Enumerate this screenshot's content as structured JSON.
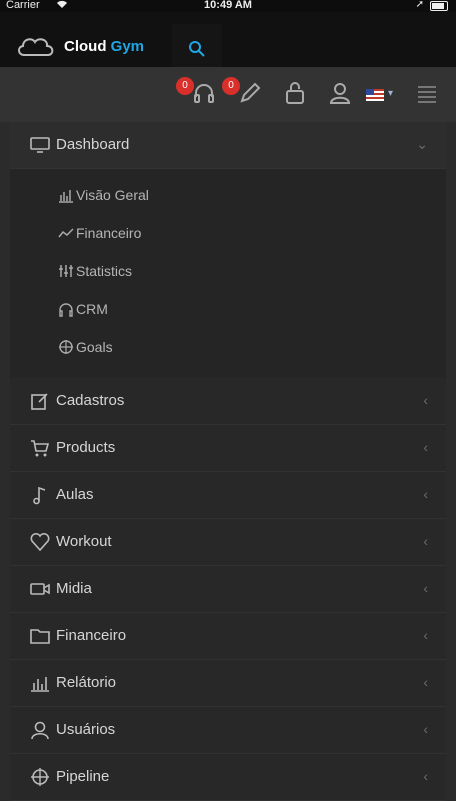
{
  "status_bar": {
    "carrier": "Carrier",
    "time": "10:49 AM"
  },
  "brand": {
    "name_part1": "Cloud",
    "name_part2": "Gym",
    "accent_color": "#1ea7e4"
  },
  "toolbar": {
    "support_badge": "0",
    "edit_badge": "0",
    "flag_icon": "us-flag-icon"
  },
  "menu": {
    "dashboard": {
      "label": "Dashboard",
      "subitems": [
        {
          "label": "Visão Geral",
          "icon": "bar-chart-icon"
        },
        {
          "label": "Financeiro",
          "icon": "line-chart-icon"
        },
        {
          "label": "Statistics",
          "icon": "equalizer-icon"
        },
        {
          "label": "CRM",
          "icon": "headphones-icon"
        },
        {
          "label": "Goals",
          "icon": "target-icon"
        }
      ]
    },
    "items": [
      {
        "label": "Cadastros",
        "icon": "edit-icon"
      },
      {
        "label": "Products",
        "icon": "cart-icon"
      },
      {
        "label": "Aulas",
        "icon": "music-note-icon"
      },
      {
        "label": "Workout",
        "icon": "heart-icon"
      },
      {
        "label": "Midia",
        "icon": "video-camera-icon"
      },
      {
        "label": "Financeiro",
        "icon": "folder-icon"
      },
      {
        "label": "Relátorio",
        "icon": "report-chart-icon"
      },
      {
        "label": "Usuários",
        "icon": "user-icon"
      },
      {
        "label": "Pipeline",
        "icon": "target-icon"
      }
    ]
  }
}
